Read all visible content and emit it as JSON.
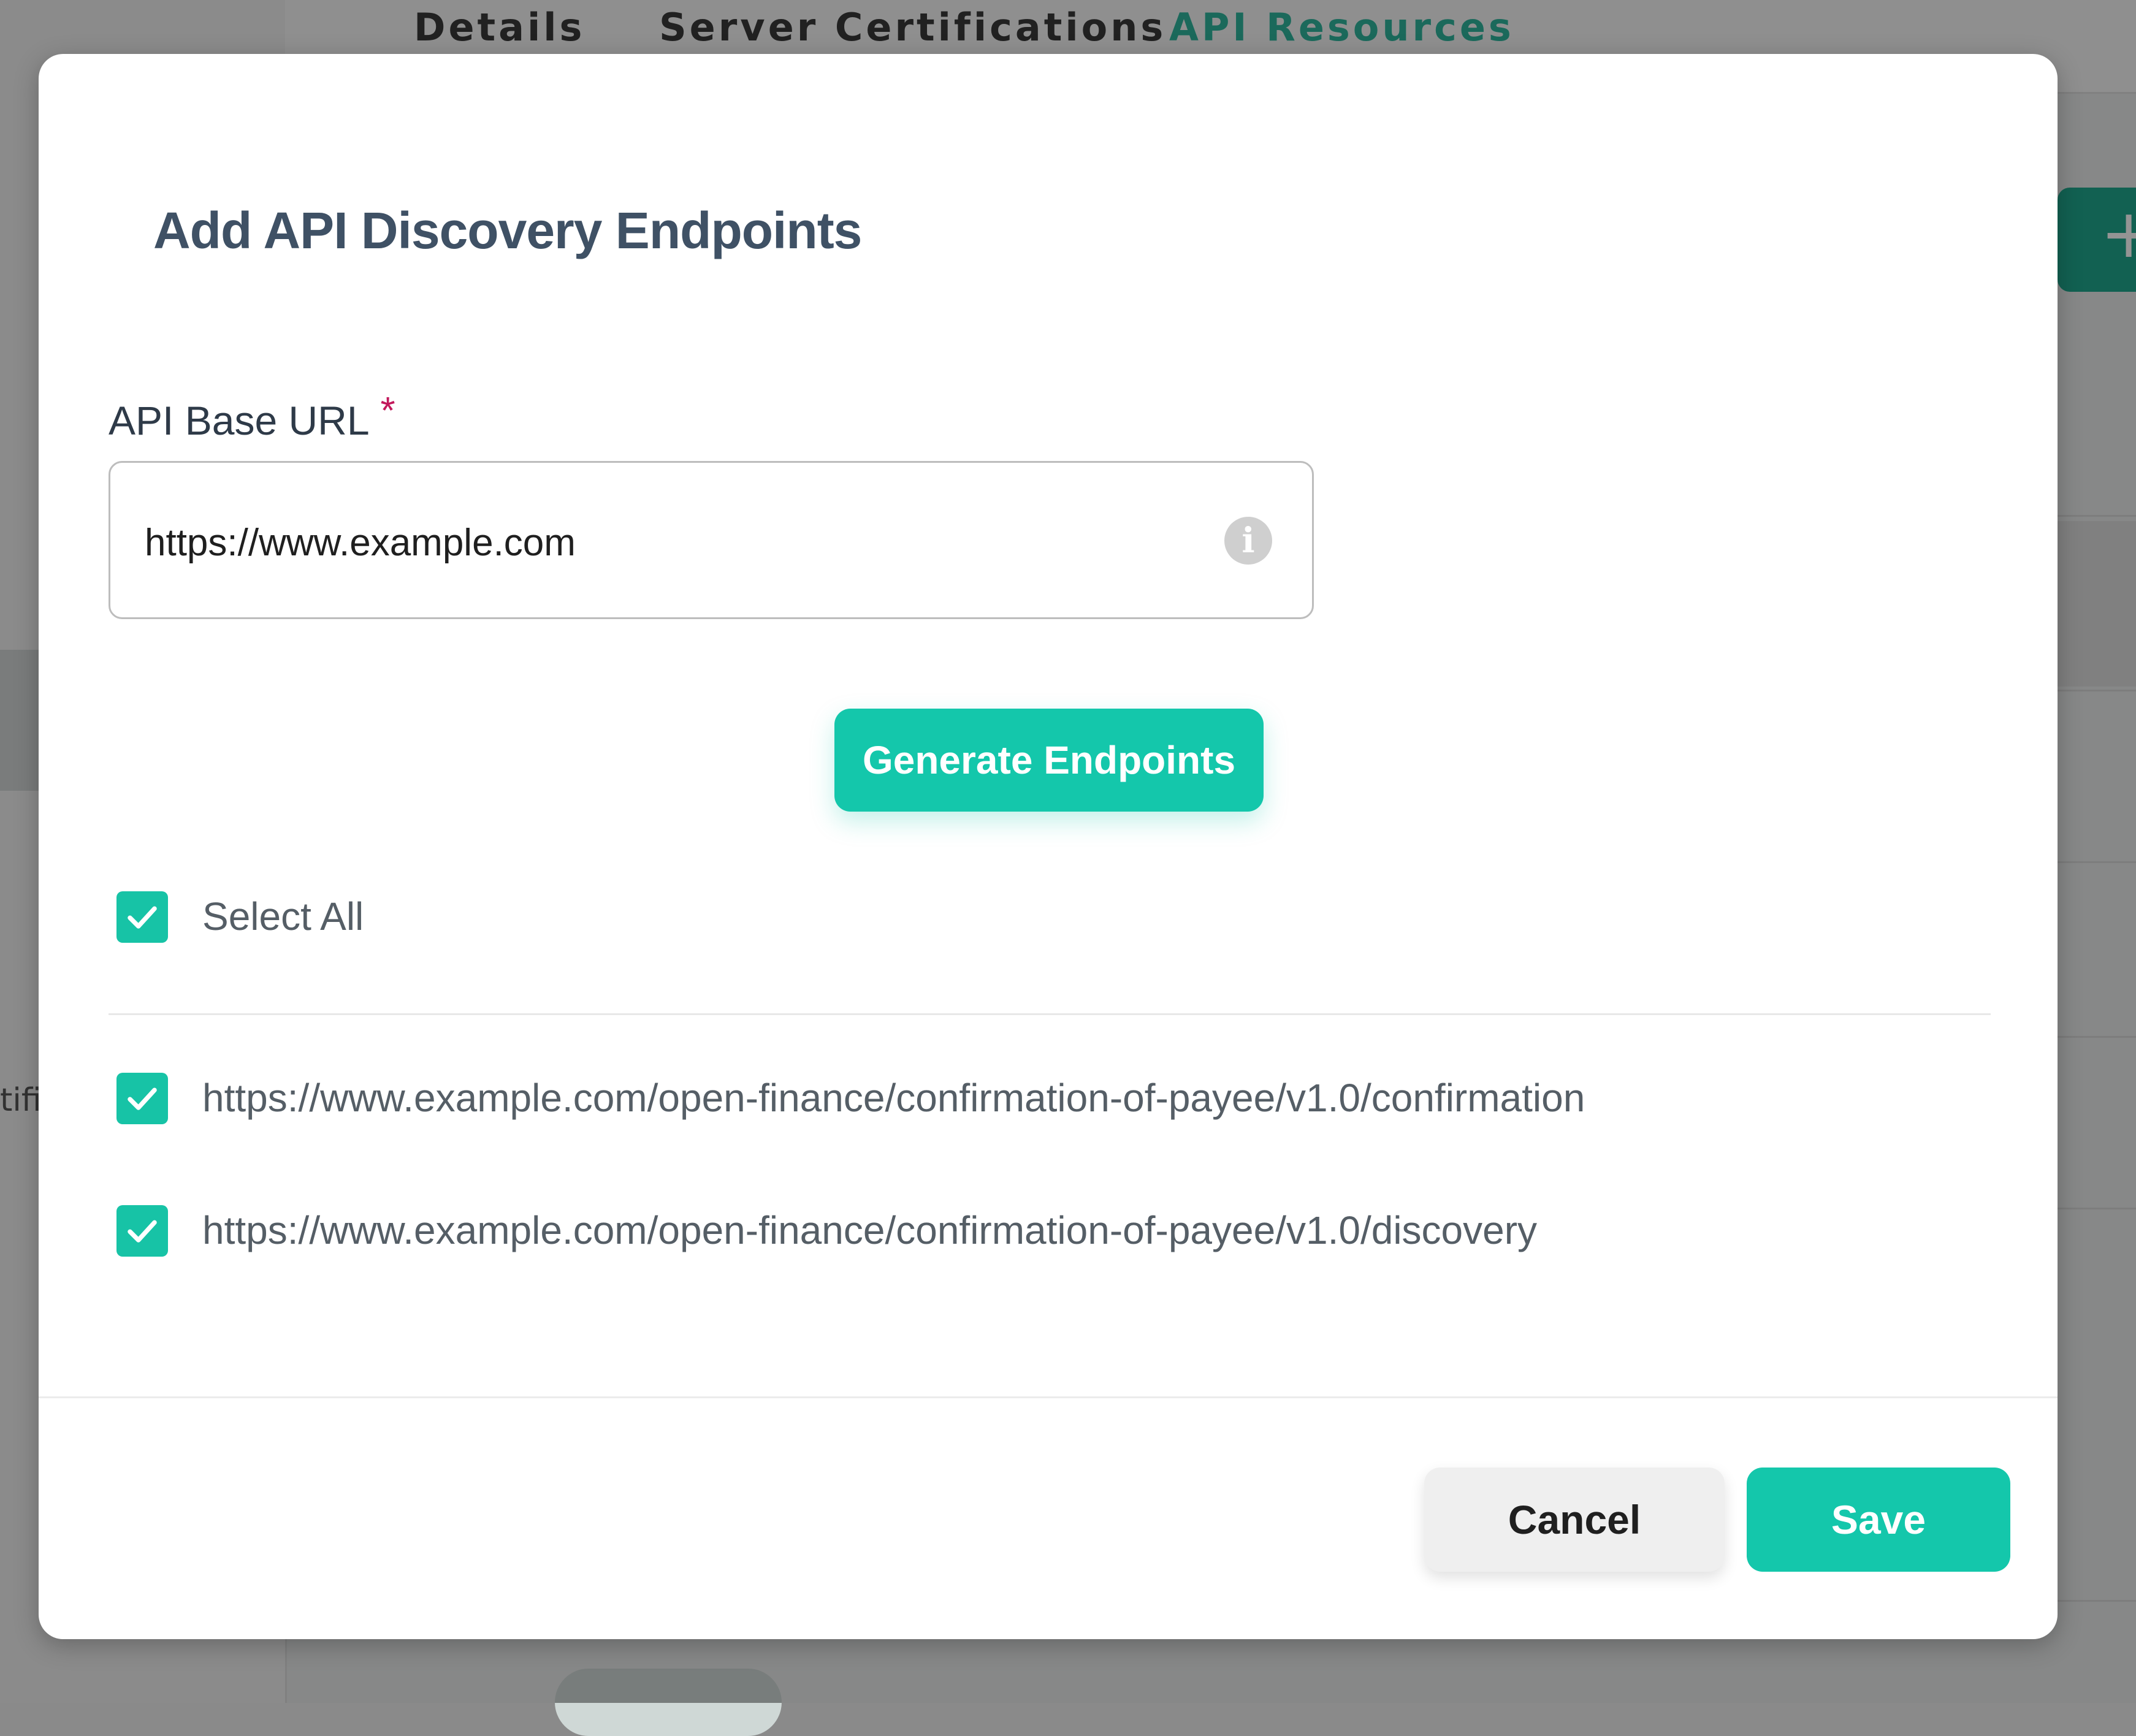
{
  "background": {
    "tabs": [
      {
        "label": "Details",
        "active": false
      },
      {
        "label": "Server Certifications",
        "active": false
      },
      {
        "label": "API Resources",
        "active": true
      }
    ],
    "sidebar_fragment": "tifi",
    "add_button_icon": "plus-icon"
  },
  "modal": {
    "title": "Add API Discovery Endpoints",
    "url_field": {
      "label": "API Base URL",
      "required_marker": "*",
      "value": "https://www.example.com",
      "icon": "info-icon"
    },
    "generate_label": "Generate Endpoints",
    "select_all": {
      "label": "Select All",
      "checked": true
    },
    "endpoints": [
      {
        "url": "https://www.example.com/open-finance/confirmation-of-payee/v1.0/confirmation",
        "checked": true
      },
      {
        "url": "https://www.example.com/open-finance/confirmation-of-payee/v1.0/discovery",
        "checked": true
      }
    ],
    "cancel_label": "Cancel",
    "save_label": "Save"
  },
  "colors": {
    "accent": "#14c7ab",
    "title": "#3f5165",
    "required": "#c2185b",
    "active_tab": "#2fb59e"
  }
}
